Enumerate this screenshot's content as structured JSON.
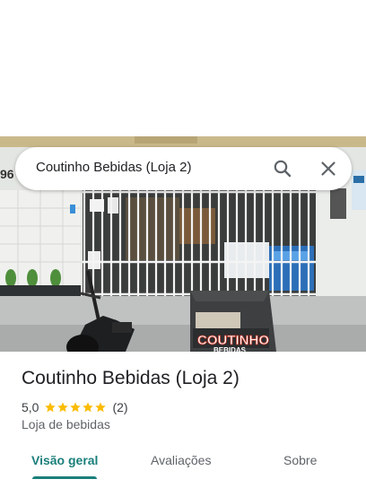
{
  "search": {
    "query": "Coutinho Bebidas (Loja 2)",
    "search_icon": "search-icon",
    "close_icon": "close-icon"
  },
  "place": {
    "name": "Coutinho Bebidas (Loja 2)",
    "rating": "5,0",
    "stars": 5,
    "review_count": "(2)",
    "category": "Loja de bebidas"
  },
  "photo": {
    "house_number": "96",
    "cart_sign": "COUTINHO",
    "cart_subtitle": "BEBIDAS"
  },
  "tabs": [
    {
      "label": "Visão geral",
      "active": true
    },
    {
      "label": "Avaliações",
      "active": false
    },
    {
      "label": "Sobre",
      "active": false
    }
  ],
  "colors": {
    "accent": "#1a7f7a",
    "star": "#fbbc04",
    "text_primary": "#202124",
    "text_secondary": "#5f6368"
  }
}
